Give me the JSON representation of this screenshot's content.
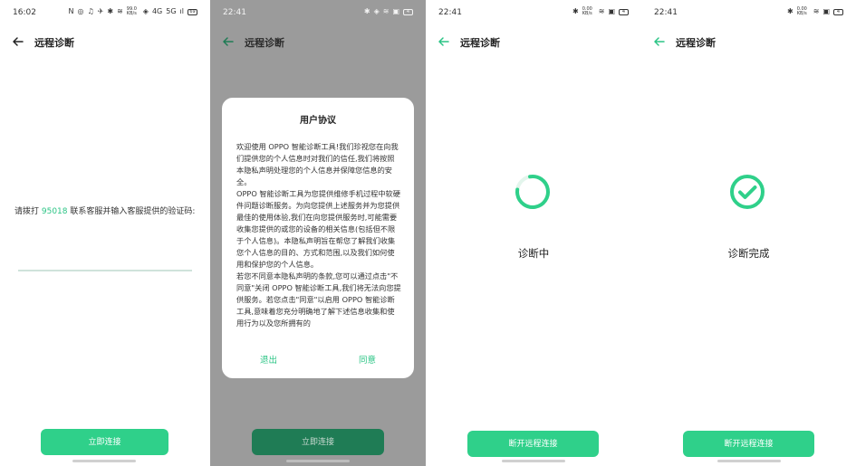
{
  "screen1": {
    "status": {
      "time": "16:02",
      "icons": [
        "N",
        "◎",
        "♫",
        "✈",
        "✱",
        "≋",
        "99.0 KB/s",
        "◈",
        "4G",
        "5G",
        "ıl"
      ],
      "battery": "69"
    },
    "header": {
      "title": "远程诊断"
    },
    "prompt": {
      "before": "请拨打 ",
      "number": "95018",
      "after": " 联系客服并输入客服提供的验证码:"
    },
    "input": {
      "value": "",
      "placeholder": ""
    },
    "button": {
      "label": "立即连接"
    }
  },
  "screen2": {
    "status": {
      "time": "22:41",
      "icons": [
        "✱",
        "◈",
        "≋",
        "▣"
      ],
      "battery": "4"
    },
    "header": {
      "title": "远程诊断"
    },
    "dialog": {
      "title": "用户协议",
      "paragraphs": [
        "欢迎使用 OPPO 智能诊断工具!我们珍视您在向我们提供您的个人信息时对我们的信任,我们将按照本隐私声明处理您的个人信息并保障您信息的安全。",
        "OPPO 智能诊断工具为您提供维修手机过程中软硬件问题诊断服务。为向您提供上述服务并为您提供最佳的使用体验,我们在向您提供服务时,可能需要收集您提供的或您的设备的相关信息(包括但不限于个人信息)。本隐私声明旨在帮您了解我们收集您个人信息的目的、方式和范围,以及我们如何使用和保护您的个人信息。",
        "若您不同意本隐私声明的条款,您可以通过点击\"不同意\"关闭 OPPO 智能诊断工具,我们将无法向您提供服务。若您点击\"同意\"以启用 OPPO 智能诊断工具,意味着您充分明确地了解下述信息收集和使用行为以及您所拥有的"
      ],
      "exit_label": "退出",
      "agree_label": "同意"
    },
    "button": {
      "label": "立即连接"
    }
  },
  "screen3": {
    "status": {
      "time": "22:41",
      "icons": [
        "✱",
        "0.00 KB/s",
        "≋",
        "▣"
      ],
      "battery": "4"
    },
    "header": {
      "title": "远程诊断"
    },
    "state_label": "诊断中",
    "progress": {
      "icon": "loading-ring-icon",
      "percent": 80
    },
    "button": {
      "label": "断开远程连接"
    }
  },
  "screen4": {
    "status": {
      "time": "22:41",
      "icons": [
        "✱",
        "0.00 KB/s",
        "≋",
        "▣"
      ],
      "battery": "4"
    },
    "header": {
      "title": "远程诊断"
    },
    "state_label": "诊断完成",
    "state_icon": "check-circle-icon",
    "button": {
      "label": "断开远程连接"
    }
  },
  "colors": {
    "accent": "#2fd08a",
    "link": "#2bc485",
    "dim_button": "#1f7c55",
    "overlay": "#9b9b9b"
  }
}
